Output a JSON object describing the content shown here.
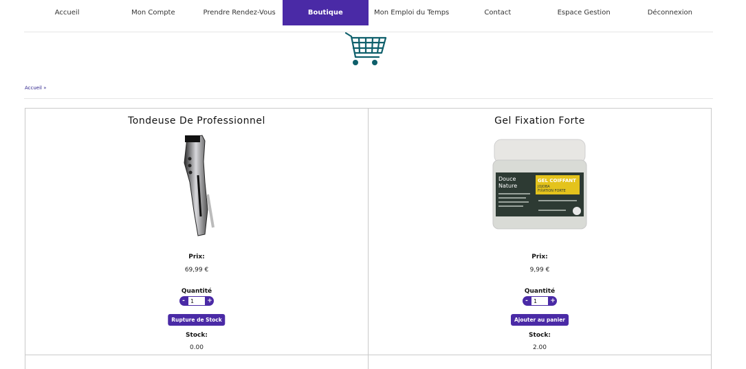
{
  "nav": {
    "items": [
      "Accueil",
      "Mon Compte",
      "Prendre Rendez-Vous",
      "Boutique",
      "Mon Emploi du Temps",
      "Contact",
      "Espace Gestion",
      "Déconnexion"
    ],
    "active": "Boutique"
  },
  "breadcrumb": "Accueil »",
  "labels": {
    "price": "Prix:",
    "quantity": "Quantité",
    "stock": "Stock:",
    "minus": "-",
    "plus": "+"
  },
  "products": [
    {
      "name": "Tondeuse De Professionnel",
      "price": "69,99 €",
      "quantity": "1",
      "button": "Rupture de Stock",
      "stock": "0.00",
      "image_icon": "hair-clipper-image"
    },
    {
      "name": "Gel Fixation Forte",
      "price": "9,99 €",
      "quantity": "1",
      "button": "Ajouter au panier",
      "stock": "2.00",
      "image_icon": "hair-gel-jar-image",
      "jar_label": {
        "brand_line1": "Douce",
        "brand_line2": "Nature",
        "title": "GEL COIFFANT",
        "sub1": "JOJOBA",
        "sub2": "FIXATION FORTE"
      }
    }
  ],
  "colors": {
    "accent": "#4a2aa6",
    "cart": "#0e5f6b",
    "border": "#c9c9c9"
  }
}
